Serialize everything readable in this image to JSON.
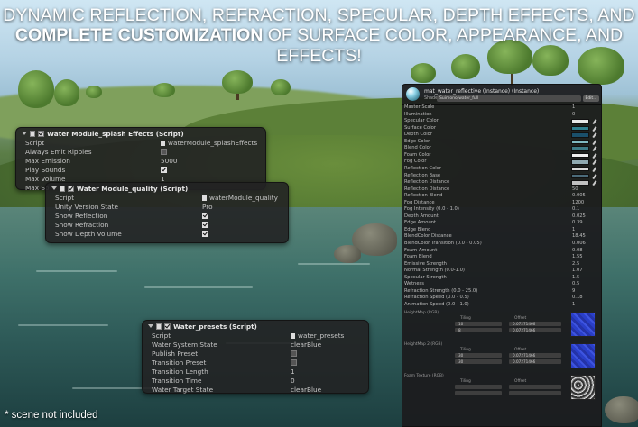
{
  "headline": {
    "line1": "DYNAMIC REFLECTION, REFRACTION, SPECULAR, DEPTH EFFECTS, AND",
    "line2_bold": "COMPLETE CUSTOMIZATION",
    "line2_rest": " OF SURFACE COLOR, APPEARANCE, AND EFFECTS!"
  },
  "splash_panel": {
    "title": "Water Module_splash Effects (Script)",
    "rows": [
      {
        "label": "Script",
        "value": "waterModule_splashEffects"
      },
      {
        "label": "Always Emit Ripples",
        "value": ""
      },
      {
        "label": "Max Emission",
        "value": "5000"
      },
      {
        "label": "Play Sounds",
        "value": ""
      },
      {
        "label": "Max Volume",
        "value": "1"
      },
      {
        "label": "Max So",
        "value": ""
      }
    ]
  },
  "quality_panel": {
    "title": "Water Module_quality (Script)",
    "rows": [
      {
        "label": "Script",
        "value": "waterModule_quality"
      },
      {
        "label": "Unity Version State",
        "value": "Pro"
      },
      {
        "label": "Show Reflection",
        "value": ""
      },
      {
        "label": "Show Refraction",
        "value": ""
      },
      {
        "label": "Show Depth Volume",
        "value": ""
      }
    ]
  },
  "presets_panel": {
    "title": "Water_presets (Script)",
    "rows": [
      {
        "label": "Script",
        "value": "water_presets"
      },
      {
        "label": "Water System State",
        "value": "clearBlue"
      },
      {
        "label": "Publish Preset",
        "value": ""
      },
      {
        "label": "Transition Preset",
        "value": ""
      },
      {
        "label": "Transition Length",
        "value": "1"
      },
      {
        "label": "Transition Time",
        "value": "0"
      },
      {
        "label": "Water Target State",
        "value": "clearBlue"
      }
    ]
  },
  "material_panel": {
    "title": "mat_water_reflective (Instance) (Instance)",
    "shader_label": "Shader",
    "shader_value": "Suimono/water_full",
    "edit_label": "Edit...",
    "props": [
      {
        "label": "Master Scale",
        "value": "1",
        "kind": "number"
      },
      {
        "label": "Illumination",
        "value": "0",
        "kind": "number"
      },
      {
        "label": "Specular Color",
        "value": "",
        "kind": "color",
        "color": "#e8e8e8"
      },
      {
        "label": "Surface Color",
        "value": "",
        "kind": "color",
        "color": "#2f7f8f"
      },
      {
        "label": "Depth Color",
        "value": "",
        "kind": "color",
        "color": "#1a4f6a"
      },
      {
        "label": "Edge Color",
        "value": "",
        "kind": "color",
        "color": "#7fb8c0"
      },
      {
        "label": "Blend Color",
        "value": "",
        "kind": "color",
        "color": "#3d7a86"
      },
      {
        "label": "Foam Color",
        "value": "",
        "kind": "color",
        "color": "#f0f0f0"
      },
      {
        "label": "Fog Color",
        "value": "",
        "kind": "color",
        "color": "#8fa8b0"
      },
      {
        "label": "Reflection Color",
        "value": "",
        "kind": "color",
        "color": "#d8d8d8"
      },
      {
        "label": "Reflection Base",
        "value": "",
        "kind": "color",
        "color": "#4b6b7a"
      },
      {
        "label": "Reflection Distance",
        "value": "",
        "kind": "color",
        "color": "#c0c0c0"
      },
      {
        "label": "Reflection Distance",
        "value": "50",
        "kind": "number"
      },
      {
        "label": "Reflection Blend",
        "value": "0.005",
        "kind": "number"
      },
      {
        "label": "Fog Distance",
        "value": "1200",
        "kind": "number"
      },
      {
        "label": "Fog Intensity (0.0 - 1.0)",
        "value": "0.1",
        "kind": "number"
      },
      {
        "label": "Depth Amount",
        "value": "0.025",
        "kind": "number"
      },
      {
        "label": "Edge Amount",
        "value": "0.39",
        "kind": "number"
      },
      {
        "label": "Edge Blend",
        "value": "1",
        "kind": "number"
      },
      {
        "label": "BlendColor Distance",
        "value": "18.45",
        "kind": "number"
      },
      {
        "label": "BlendColor Transition (0.0 - 0.05)",
        "value": "0.006",
        "kind": "number"
      },
      {
        "label": "Foam Amount",
        "value": "0.08",
        "kind": "number"
      },
      {
        "label": "Foam Blend",
        "value": "1.55",
        "kind": "number"
      },
      {
        "label": "Emissive Strength",
        "value": "2.5",
        "kind": "number"
      },
      {
        "label": "Normal Strength (0.0-1.0)",
        "value": "1.07",
        "kind": "number"
      },
      {
        "label": "Specular Strength",
        "value": "1.5",
        "kind": "number"
      },
      {
        "label": "Wetness",
        "value": "0.5",
        "kind": "number"
      },
      {
        "label": "Refraction Strength (0.0 - 25.0)",
        "value": "9",
        "kind": "number"
      },
      {
        "label": "Refraction Speed (0.0 - 0.5)",
        "value": "0.18",
        "kind": "number"
      },
      {
        "label": "Animation Speed (0.0 - 1.0)",
        "value": "1",
        "kind": "number"
      }
    ],
    "textures": [
      {
        "label": "HeightMap (RGB)",
        "tiling_label": "Tiling",
        "offset_label": "Offset",
        "x": "10",
        "y": "8",
        "off_x": "0.07271466",
        "off_y": "0.07271466",
        "style": "blue"
      },
      {
        "label": "HeightMap 2 (RGB)",
        "tiling_label": "Tiling",
        "offset_label": "Offset",
        "x": "30",
        "y": "30",
        "off_x": "0.07271466",
        "off_y": "0.07271466",
        "style": "blue"
      },
      {
        "label": "Foam Texture (RGB)",
        "tiling_label": "Tiling",
        "offset_label": "Offset",
        "x": "",
        "y": "",
        "off_x": "",
        "off_y": "",
        "style": "noise"
      }
    ]
  },
  "footnote": "* scene not included"
}
